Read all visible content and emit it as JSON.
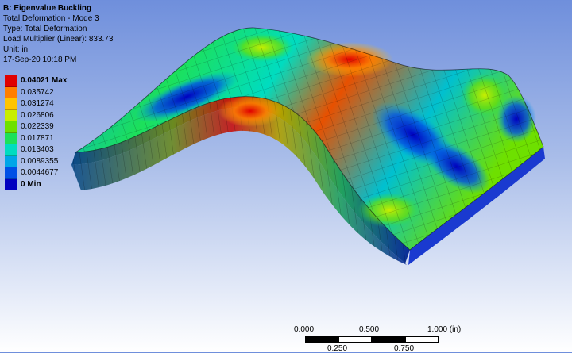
{
  "info": {
    "title": "B: Eigenvalue Buckling",
    "line1": "Total Deformation - Mode 3",
    "line2": "Type: Total Deformation",
    "line3": "Load Multiplier (Linear): 833.73",
    "line4": "Unit: in",
    "line5": "17-Sep-20 10:18 PM"
  },
  "legend": [
    {
      "label": "0.04021 Max",
      "color": "#e00000",
      "bold": true
    },
    {
      "label": "0.035742",
      "color": "#ff7f00",
      "bold": false
    },
    {
      "label": "0.031274",
      "color": "#ffc400",
      "bold": false
    },
    {
      "label": "0.026806",
      "color": "#c8ee00",
      "bold": false
    },
    {
      "label": "0.022339",
      "color": "#6ee000",
      "bold": false
    },
    {
      "label": "0.017871",
      "color": "#1ce05a",
      "bold": false
    },
    {
      "label": "0.013403",
      "color": "#00dcc0",
      "bold": false
    },
    {
      "label": "0.0089355",
      "color": "#00a6e8",
      "bold": false
    },
    {
      "label": "0.0044677",
      "color": "#0050e6",
      "bold": false
    },
    {
      "label": "0 Min",
      "color": "#0000c0",
      "bold": true
    }
  ],
  "scalebar": {
    "top_labels": [
      "0.000",
      "0.500",
      "1.000 (in)"
    ],
    "bottom_labels": [
      "0.250",
      "0.750"
    ]
  }
}
